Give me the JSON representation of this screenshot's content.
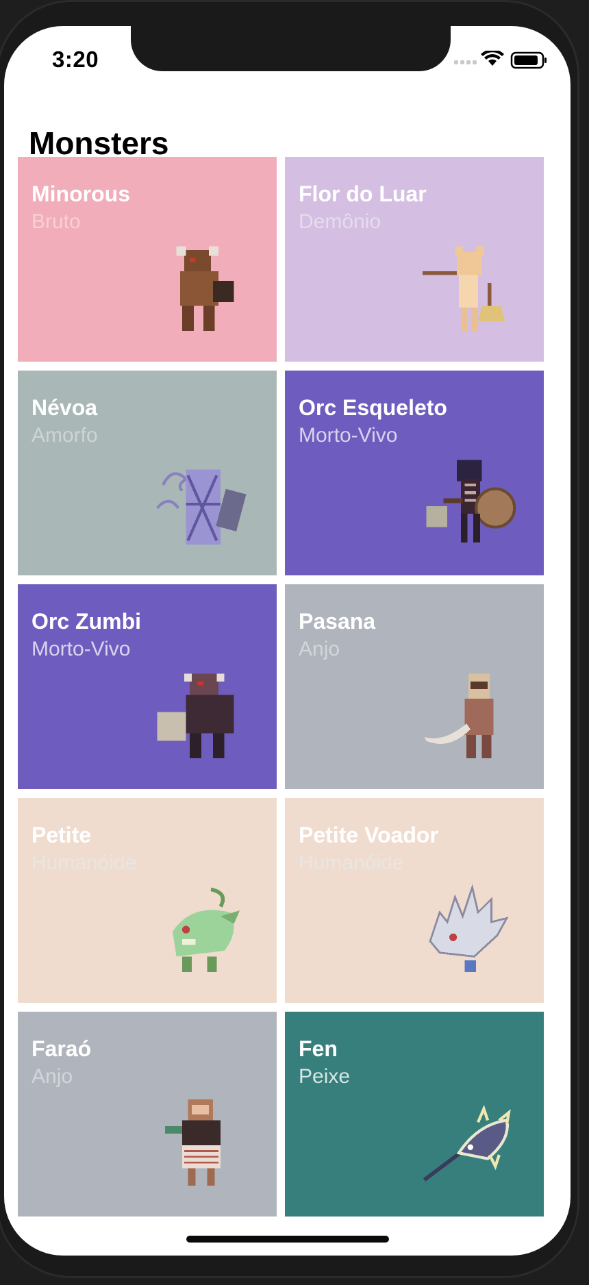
{
  "status_bar": {
    "time": "3:20"
  },
  "page": {
    "title": "Monsters"
  },
  "monsters": [
    {
      "name": "Minorous",
      "type": "Bruto",
      "bg": "#f1adb9",
      "type_color": "#f7d0d6",
      "sprite": "minotaur-icon"
    },
    {
      "name": "Flor do Luar",
      "type": "Demônio",
      "bg": "#d4bfe2",
      "type_color": "#e6dcee",
      "sprite": "fox-spirit-icon"
    },
    {
      "name": "Névoa",
      "type": "Amorfo",
      "bg": "#a9b7b6",
      "type_color": "#ccd5d4",
      "sprite": "mist-icon"
    },
    {
      "name": "Orc Esqueleto",
      "type": "Morto-Vivo",
      "bg": "#6e5dbe",
      "type_color": "#d8d4ee",
      "sprite": "skeleton-orc-icon"
    },
    {
      "name": "Orc Zumbi",
      "type": "Morto-Vivo",
      "bg": "#6e5dbe",
      "type_color": "#d8d4ee",
      "sprite": "zombie-orc-icon"
    },
    {
      "name": "Pasana",
      "type": "Anjo",
      "bg": "#b0b5bd",
      "type_color": "#d2d6db",
      "sprite": "pasana-icon"
    },
    {
      "name": "Petite",
      "type": "Humanóide",
      "bg": "#f0dccf",
      "type_color": "#e8e6e4",
      "sprite": "green-dragon-icon"
    },
    {
      "name": "Petite Voador",
      "type": "Humanóide",
      "bg": "#f0dccf",
      "type_color": "#e8e6e4",
      "sprite": "white-dragon-icon"
    },
    {
      "name": "Faraó",
      "type": "Anjo",
      "bg": "#b0b5bd",
      "type_color": "#d2d6db",
      "sprite": "pharaoh-icon"
    },
    {
      "name": "Fen",
      "type": "Peixe",
      "bg": "#367f7c",
      "type_color": "#d6e6e4",
      "sprite": "swordfish-icon"
    }
  ]
}
